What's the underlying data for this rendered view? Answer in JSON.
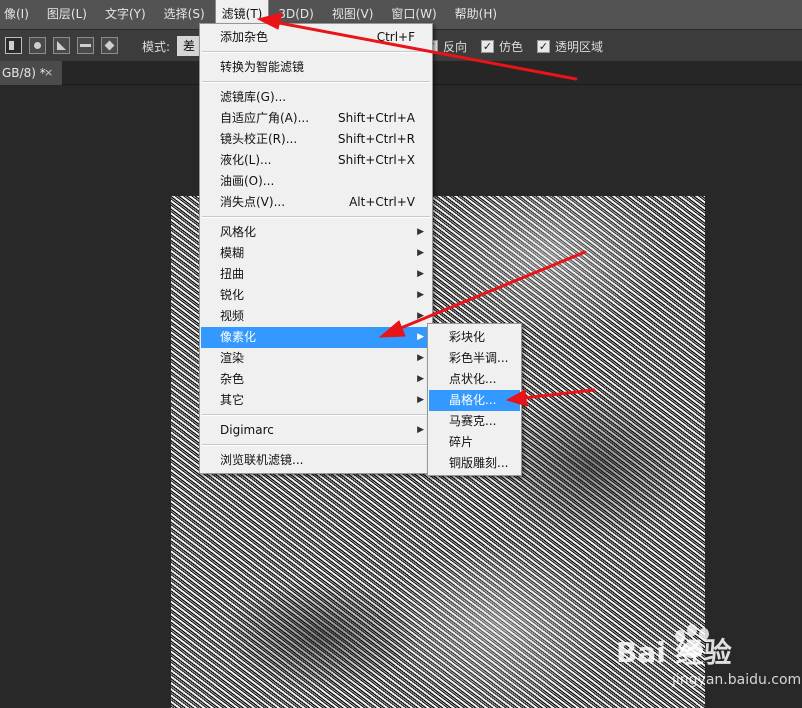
{
  "menubar": {
    "items": [
      "像(I)",
      "图层(L)",
      "文字(Y)",
      "选择(S)",
      "滤镜(T)",
      "3D(D)",
      "视图(V)",
      "窗口(W)",
      "帮助(H)"
    ],
    "active_index": 4
  },
  "options": {
    "mode_label": "模式:",
    "mode_value": "差",
    "checkboxes": [
      {
        "label": "反向",
        "checked": true
      },
      {
        "label": "仿色",
        "checked": true
      },
      {
        "label": "透明区域",
        "checked": true
      }
    ]
  },
  "document": {
    "tab_title": "GB/8) *",
    "close_glyph": "×"
  },
  "filter_menu": {
    "items": [
      {
        "label": "添加杂色",
        "shortcut": "Ctrl+F"
      },
      {
        "label": "转换为智能滤镜"
      },
      {
        "label": "滤镜库(G)..."
      },
      {
        "label": "自适应广角(A)...",
        "shortcut": "Shift+Ctrl+A"
      },
      {
        "label": "镜头校正(R)...",
        "shortcut": "Shift+Ctrl+R"
      },
      {
        "label": "液化(L)...",
        "shortcut": "Shift+Ctrl+X"
      },
      {
        "label": "油画(O)..."
      },
      {
        "label": "消失点(V)...",
        "shortcut": "Alt+Ctrl+V"
      },
      {
        "label": "风格化",
        "submenu": true
      },
      {
        "label": "模糊",
        "submenu": true
      },
      {
        "label": "扭曲",
        "submenu": true
      },
      {
        "label": "锐化",
        "submenu": true
      },
      {
        "label": "视频",
        "submenu": true
      },
      {
        "label": "像素化",
        "submenu": true,
        "highlighted": true
      },
      {
        "label": "渲染",
        "submenu": true
      },
      {
        "label": "杂色",
        "submenu": true
      },
      {
        "label": "其它",
        "submenu": true
      },
      {
        "label": "Digimarc",
        "submenu": true
      },
      {
        "label": "浏览联机滤镜..."
      }
    ]
  },
  "pixelate_submenu": {
    "items": [
      {
        "label": "彩块化"
      },
      {
        "label": "彩色半调..."
      },
      {
        "label": "点状化..."
      },
      {
        "label": "晶格化...",
        "highlighted": true
      },
      {
        "label": "马赛克..."
      },
      {
        "label": "碎片"
      },
      {
        "label": "铜版雕刻..."
      }
    ]
  },
  "watermark": {
    "brand": "Bai 经验",
    "url": "jingyan.baidu.com"
  },
  "colors": {
    "highlight": "#3399ff",
    "annotation_arrow": "#e8141a",
    "menubar_bg": "#535353",
    "menu_bg": "#f0f0f0"
  },
  "icons": {
    "submenu_arrow": "▶",
    "check": "✓"
  }
}
